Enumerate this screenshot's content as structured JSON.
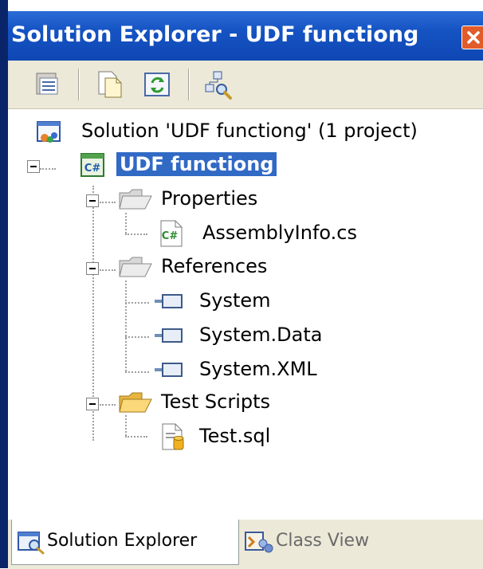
{
  "window": {
    "title": "Solution Explorer - UDF functiong"
  },
  "toolbar": {
    "buttons": [
      {
        "icon": "properties-icon"
      },
      {
        "icon": "show-all-files-icon"
      },
      {
        "icon": "refresh-icon"
      },
      {
        "icon": "class-diagram-icon"
      }
    ]
  },
  "tree": {
    "solution": "Solution 'UDF functiong' (1 project)",
    "project": "UDF functiong",
    "properties": "Properties",
    "assembly_info": "AssemblyInfo.cs",
    "references": "References",
    "ref_system": "System",
    "ref_system_data": "System.Data",
    "ref_system_xml": "System.XML",
    "test_scripts": "Test Scripts",
    "test_sql": "Test.sql"
  },
  "tabs": {
    "solution_explorer": "Solution Explorer",
    "class_view": "Class View"
  },
  "colors": {
    "title_bar": "#1553c3",
    "selection": "#316ac5",
    "close_button": "#e25b2a"
  }
}
